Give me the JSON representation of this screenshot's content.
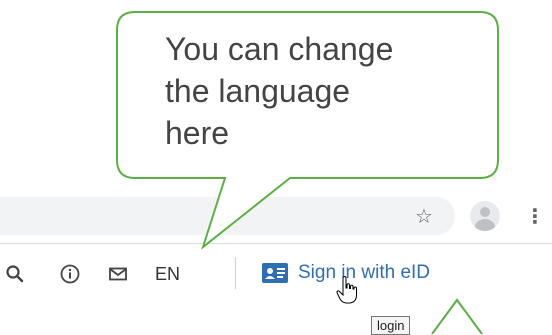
{
  "callout": {
    "text_lines": [
      "You can change",
      "the language",
      "here"
    ]
  },
  "browser": {
    "bookmark_icon": "star-icon",
    "profile_icon": "avatar-icon",
    "menu_icon": "kebab-menu-icon"
  },
  "toolbar": {
    "search_icon": "search-icon",
    "info_icon": "info-icon",
    "mail_icon": "mail-icon",
    "language": "EN",
    "signin_label": "Sign in with eID"
  },
  "tooltip": {
    "text": "login"
  },
  "colors": {
    "callout_border": "#5bb043",
    "link": "#2f6db5"
  }
}
